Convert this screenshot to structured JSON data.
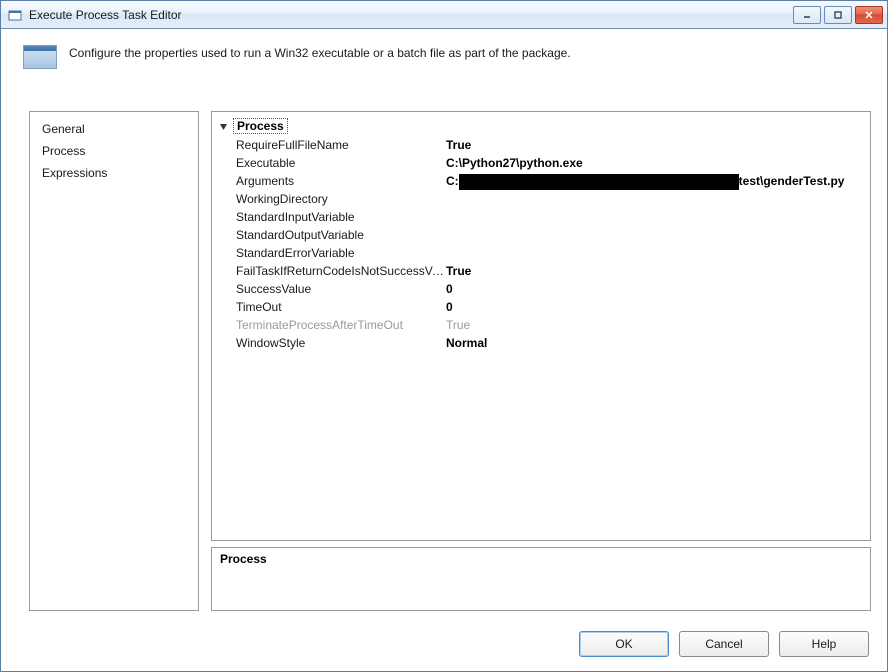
{
  "window": {
    "title": "Execute Process Task Editor"
  },
  "description": "Configure the properties used to run a Win32 executable or a batch file as part of the package.",
  "sidebar": {
    "items": [
      "General",
      "Process",
      "Expressions"
    ]
  },
  "category": "Process",
  "props": [
    {
      "name": "RequireFullFileName",
      "value": "True"
    },
    {
      "name": "Executable",
      "value": "C:\\Python27\\python.exe"
    },
    {
      "name": "Arguments",
      "value_prefix": "C:",
      "value_suffix": "test\\genderTest.py",
      "redacted": true
    },
    {
      "name": "WorkingDirectory",
      "value": ""
    },
    {
      "name": "StandardInputVariable",
      "value": ""
    },
    {
      "name": "StandardOutputVariable",
      "value": ""
    },
    {
      "name": "StandardErrorVariable",
      "value": ""
    },
    {
      "name": "FailTaskIfReturnCodeIsNotSuccessValue",
      "value": "True"
    },
    {
      "name": "SuccessValue",
      "value": "0"
    },
    {
      "name": "TimeOut",
      "value": "0"
    },
    {
      "name": "TerminateProcessAfterTimeOut",
      "value": "True",
      "disabled": true
    },
    {
      "name": "WindowStyle",
      "value": "Normal"
    }
  ],
  "help_pane": {
    "title": "Process"
  },
  "buttons": {
    "ok": "OK",
    "cancel": "Cancel",
    "help": "Help"
  }
}
